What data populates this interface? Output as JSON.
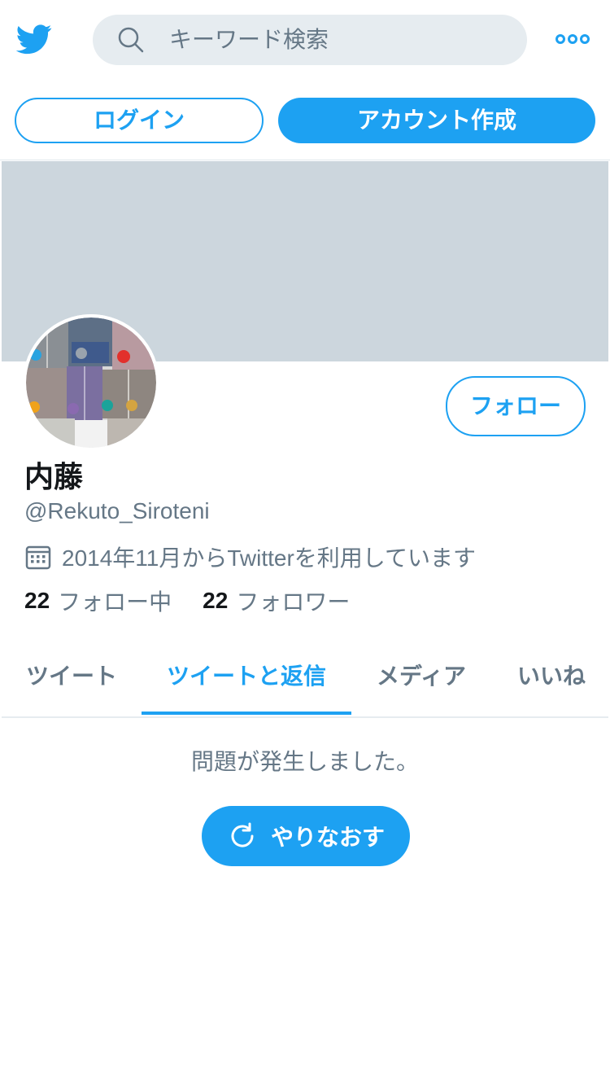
{
  "header": {
    "logo_icon": "twitter-bird-icon",
    "search": {
      "icon": "search-icon",
      "placeholder": "キーワード検索"
    },
    "more_icon": "more-dots-icon",
    "login_label": "ログイン",
    "signup_label": "アカウント作成"
  },
  "profile": {
    "display_name": "内藤",
    "handle": "@Rekuto_Siroteni",
    "joined_text": "2014年11月からTwitterを利用しています",
    "follow_label": "フォロー",
    "following_count": "22",
    "following_label": "フォロー中",
    "followers_count": "22",
    "followers_label": "フォロワー"
  },
  "tabs": [
    {
      "label": "ツイート",
      "active": false
    },
    {
      "label": "ツイートと返信",
      "active": true
    },
    {
      "label": "メディア",
      "active": false
    },
    {
      "label": "いいね",
      "active": false
    }
  ],
  "error": {
    "message": "問題が発生しました。",
    "retry_label": "やりなおす"
  },
  "colors": {
    "accent": "#1da1f2",
    "banner": "#ccd6dd",
    "secondary_text": "#657786",
    "search_bg": "#e6ecf0"
  }
}
